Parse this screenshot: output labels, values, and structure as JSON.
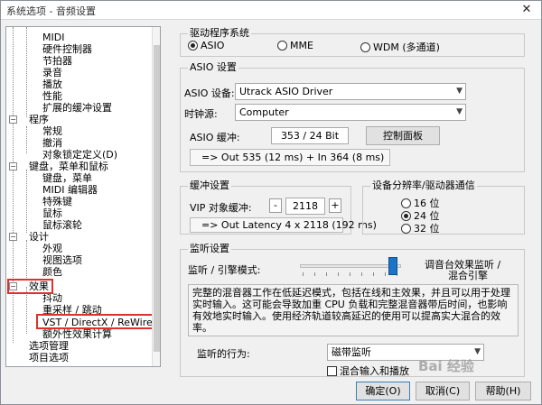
{
  "window": {
    "title": "系统选项 - 音频设置",
    "close": "✕"
  },
  "tree": {
    "items": [
      {
        "label": "MIDI",
        "name": "tree-item-midi"
      },
      {
        "label": "硬件控制器",
        "name": "tree-item-hardware-controller"
      },
      {
        "label": "节拍器",
        "name": "tree-item-metronome"
      },
      {
        "label": "录音",
        "name": "tree-item-recording"
      },
      {
        "label": "播放",
        "name": "tree-item-playback"
      },
      {
        "label": "性能",
        "name": "tree-item-performance"
      },
      {
        "label": "扩展的缓冲设置",
        "name": "tree-item-extended-buffer"
      },
      {
        "label": "程序",
        "name": "tree-item-program"
      },
      {
        "label": "常规",
        "name": "tree-item-general"
      },
      {
        "label": "撤消",
        "name": "tree-item-undo"
      },
      {
        "label": "对象锁定定义(D)",
        "name": "tree-item-object-lock"
      },
      {
        "label": "键盘，菜单和鼠标",
        "name": "tree-item-keyboard-menu-mouse"
      },
      {
        "label": "键盘，菜单",
        "name": "tree-item-keyboard-menu"
      },
      {
        "label": "MIDI 编辑器",
        "name": "tree-item-midi-editor"
      },
      {
        "label": "特殊键",
        "name": "tree-item-special-keys"
      },
      {
        "label": "鼠标",
        "name": "tree-item-mouse"
      },
      {
        "label": "鼠标滚轮",
        "name": "tree-item-mouse-wheel"
      },
      {
        "label": "设计",
        "name": "tree-item-design"
      },
      {
        "label": "外观",
        "name": "tree-item-appearance"
      },
      {
        "label": "视图选项",
        "name": "tree-item-view-options"
      },
      {
        "label": "颜色",
        "name": "tree-item-colors"
      },
      {
        "label": "效果",
        "name": "tree-item-effects"
      },
      {
        "label": "抖动",
        "name": "tree-item-dither"
      },
      {
        "label": "重采样 / 跳动",
        "name": "tree-item-resample"
      },
      {
        "label": "VST / DirectX / ReWire 设置",
        "name": "tree-item-vst-settings"
      },
      {
        "label": "额外性效果计算",
        "name": "tree-item-extra-effects"
      },
      {
        "label": "选项管理",
        "name": "tree-item-option-manager"
      },
      {
        "label": "项目选项",
        "name": "tree-item-project-options"
      }
    ],
    "expanders": {
      "collapse": "−"
    }
  },
  "driver": {
    "group_title": "驱动程序系统",
    "options": [
      "ASIO",
      "MME",
      "WDM (多通道)"
    ]
  },
  "asio": {
    "group_title": "ASIO 设置",
    "device_label": "ASIO 设备:",
    "device_value": "Utrack ASIO Driver",
    "clock_label": "时钟源:",
    "clock_value": "Computer",
    "buffer_label": "ASIO 缓冲:",
    "buffer_value": "353 / 24 Bit",
    "control_panel_button": "控制面板",
    "latency_info": "=> Out 535 (12 ms) + In 364 (8 ms)"
  },
  "buffer": {
    "group_title": "缓冲设置",
    "vip_label": "VIP 对象缓冲:",
    "minus": "-",
    "value": "2118",
    "plus": "+",
    "latency_info": "=> Out Latency 4 x 2118 (192 ms)"
  },
  "resolution": {
    "group_title": "设备分辨率/驱动器通信",
    "options": [
      "16 位",
      "24 位",
      "32 位"
    ]
  },
  "monitor": {
    "group_title": "监听设置",
    "mode_label": "监听 / 引擎模式:",
    "right_label_1": "调音台效果监听 /",
    "right_label_2": "混合引擎",
    "description": "完整的混音器工作在低延迟模式，包括在线和主效果，并且可以用于处理实时输入。这可能会导致加重 CPU 负载和完整混音器带后时间，也影响有效地实时输入。使用经济轨道较高延迟的使用可以提高实大混合的效率。",
    "behavior_label": "监听的行为:",
    "behavior_value": "磁带监听",
    "mix_checkbox_label": "混合输入和播放"
  },
  "buttons": {
    "ok": "确定(O)",
    "cancel": "取消(C)",
    "help": "帮助(H)"
  },
  "watermark": "Bai 经验",
  "colors": {
    "highlight": "#e0302b",
    "slider_thumb": "#1c73c7"
  }
}
